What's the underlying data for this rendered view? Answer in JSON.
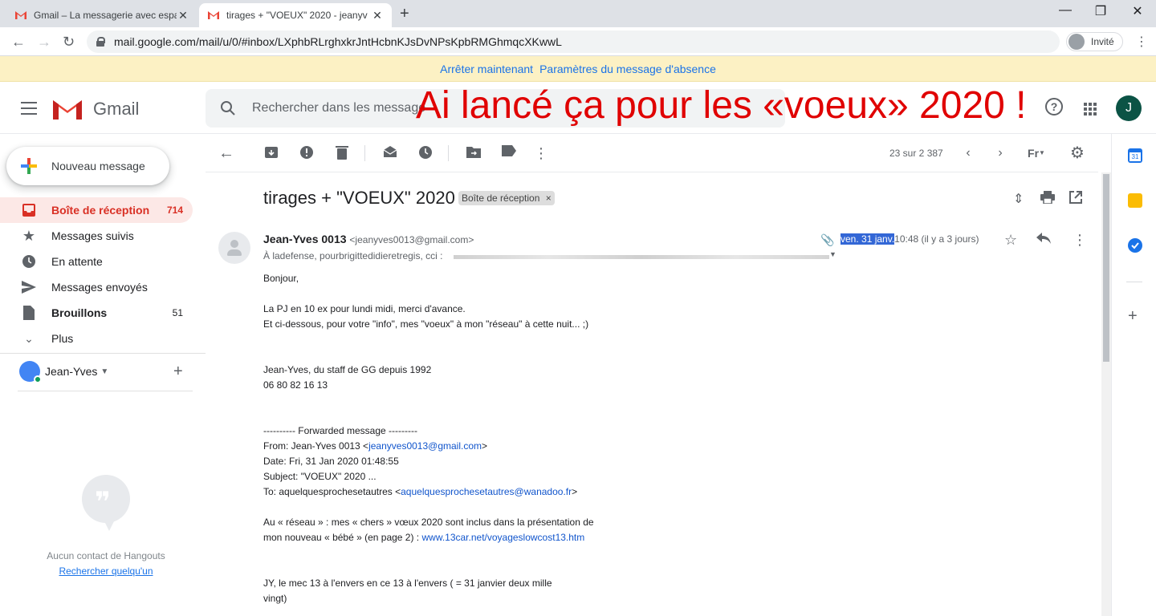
{
  "browser": {
    "tabs": [
      {
        "title": "Gmail – La messagerie avec espa",
        "active": false
      },
      {
        "title": "tirages + \"VOEUX\" 2020 - jeanyv",
        "active": true
      }
    ],
    "url": "mail.google.com/mail/u/0/#inbox/LXphbRLrghxkrJntHcbnKJsDvNPsKpbRMGhmqcXKwwL",
    "profile_label": "Invité"
  },
  "banner": {
    "stop_label": "Arrêter maintenant",
    "settings_label": "Paramètres du message d'absence"
  },
  "header": {
    "app_name": "Gmail",
    "search_placeholder": "Rechercher dans les message",
    "overlay_text": "Ai lancé ça pour les «voeux» 2020 !",
    "account_initial": "J"
  },
  "sidebar": {
    "compose_label": "Nouveau message",
    "items": [
      {
        "label": "Boîte de réception",
        "count": "714",
        "icon": "inbox-icon"
      },
      {
        "label": "Messages suivis",
        "count": "",
        "icon": "star-icon"
      },
      {
        "label": "En attente",
        "count": "",
        "icon": "clock-icon"
      },
      {
        "label": "Messages envoyés",
        "count": "",
        "icon": "send-icon"
      },
      {
        "label": "Brouillons",
        "count": "51",
        "icon": "draft-icon"
      },
      {
        "label": "Plus",
        "count": "",
        "icon": "chevron-down-icon"
      }
    ],
    "hangouts_user": "Jean-Yves",
    "no_contacts": "Aucun contact de Hangouts",
    "find_someone": "Rechercher quelqu'un"
  },
  "toolbar": {
    "pager": "23 sur 2 387",
    "lang": "Fr"
  },
  "message": {
    "subject": "tirages + \"VOEUX\" 2020",
    "label_chip": "Boîte de réception",
    "sender_name": "Jean-Yves 0013",
    "sender_email": "<jeanyves0013@gmail.com>",
    "recipients": "À ladefense, pourbrigittedidieretregis, cci :",
    "date_highlight": "ven. 31 janv.",
    "date_rest": "10:48 (il y a 3 jours)",
    "body": {
      "greeting": "Bonjour,",
      "line1": "La PJ en 10 ex pour lundi midi, merci d'avance.",
      "line2": "Et ci-dessous, pour votre \"info\", mes \"voeux\" à mon \"réseau\" à cette nuit...  ;)",
      "sig1": "Jean-Yves, du staff de GG depuis 1992",
      "sig2": "06 80 82 16 13",
      "fwd_header": "---------- Forwarded message ---------",
      "from_prefix": "From: Jean-Yves 0013 <",
      "from_email": "jeanyves0013@gmail.com",
      "from_suffix": ">",
      "date_line": "Date: Fri, 31 Jan 2020 01:48:55",
      "subject_line": "Subject: \"VOEUX\" 2020 ...",
      "to_prefix": "To: aquelquesprochesetautres <",
      "to_email": "aquelquesprochesetautres@wanadoo.fr",
      "to_suffix": ">",
      "para1": "Au « réseau » : mes « chers » vœux 2020 sont inclus dans la présentation de",
      "para2_prefix": "mon nouveau « bébé » (en page 2) : ",
      "para2_link": "www.13car.net/voyageslowcost13.htm",
      "para3a": "JY, le mec 13 à l'envers en ce 13 à l'envers ( = 31 janvier deux mille",
      "para3b": "vingt)"
    }
  },
  "colors": {
    "accent_red": "#d93025",
    "link_blue": "#1a73e8",
    "banner_bg": "#fcf1c4",
    "overlay_red": "#e00000"
  }
}
